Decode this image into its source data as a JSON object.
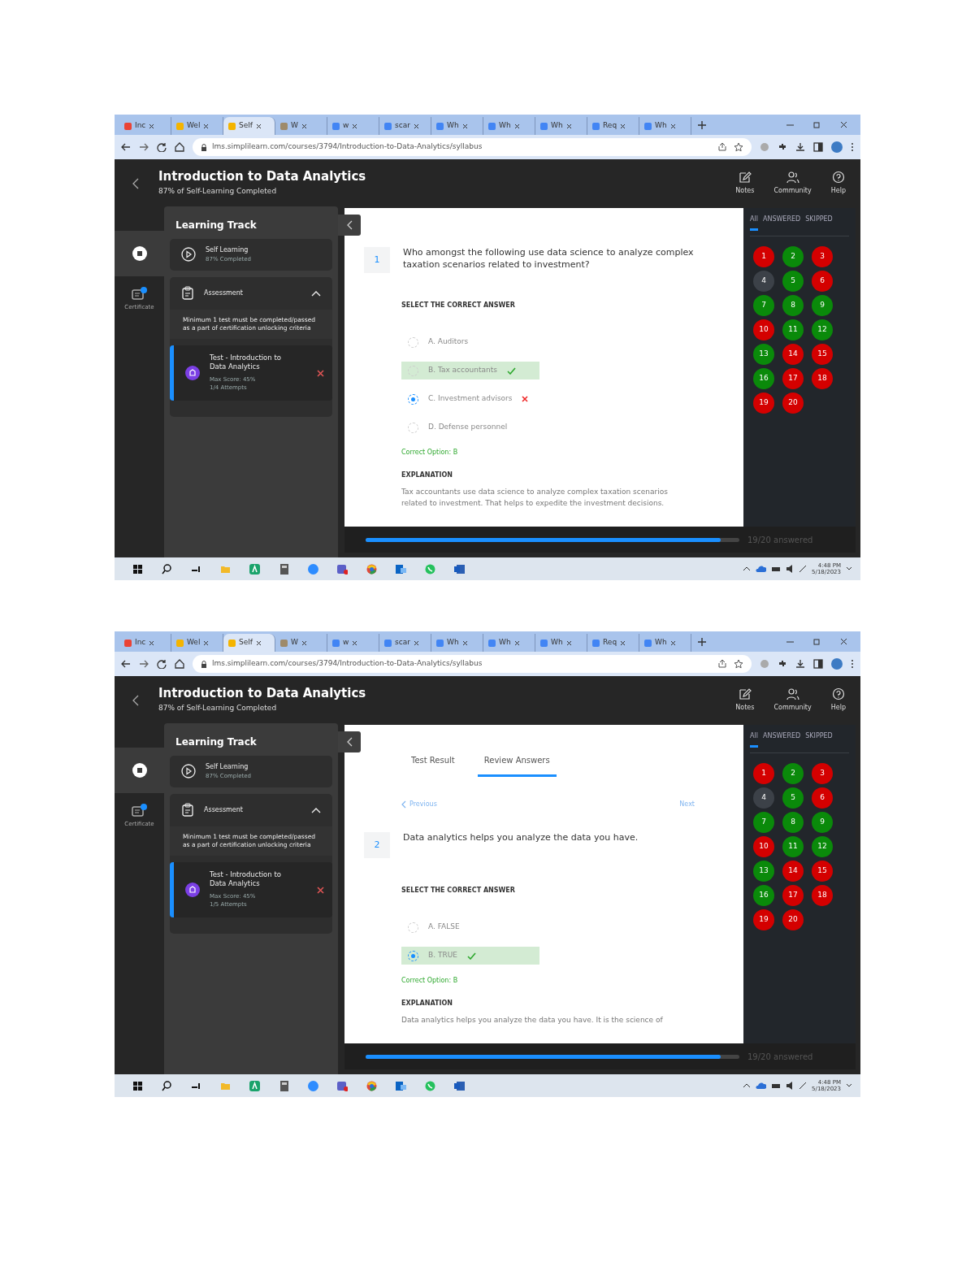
{
  "screens": [
    {
      "browser": {
        "tabs": [
          {
            "title": "Inc",
            "selected": false,
            "color": "#ea4335"
          },
          {
            "title": "Wel",
            "selected": false,
            "color": "#f4b400"
          },
          {
            "title": "Self",
            "selected": true,
            "color": "#f4b400"
          },
          {
            "title": "W",
            "selected": false,
            "color": "#9e8a6a"
          },
          {
            "title": "w",
            "selected": false,
            "color": "#4285f4"
          },
          {
            "title": "scar",
            "selected": false,
            "color": "#4285f4"
          },
          {
            "title": "Wh",
            "selected": false,
            "color": "#4285f4"
          },
          {
            "title": "Wh",
            "selected": false,
            "color": "#4285f4"
          },
          {
            "title": "Wh",
            "selected": false,
            "color": "#4285f4"
          },
          {
            "title": "Req",
            "selected": false,
            "color": "#4285f4"
          },
          {
            "title": "Wh",
            "selected": false,
            "color": "#4285f4"
          }
        ],
        "url": "lms.simplilearn.com/courses/3794/Introduction-to-Data-Analytics/syllabus"
      },
      "header": {
        "title": "Introduction to Data Analytics",
        "subtitle": "87% of Self-Learning Completed",
        "actions": [
          {
            "kind": "notes",
            "label": "Notes"
          },
          {
            "kind": "community",
            "label": "Community"
          },
          {
            "kind": "help",
            "label": "Help"
          }
        ]
      },
      "rail": [
        {
          "kind": "home",
          "selected": true
        },
        {
          "kind": "certificate",
          "label": "Certificate",
          "selected": false
        }
      ],
      "learning_track": {
        "title": "Learning Track",
        "self_learning": {
          "title": "Self Learning",
          "progress": "87% Completed"
        },
        "assessment": {
          "title": "Assessment",
          "expanded": true,
          "note": "Minimum 1 test must be completed/passed as a part of certification unlocking criteria",
          "test": {
            "title": "Test - Introduction to Data Analytics",
            "score": "Max Score: 45%",
            "attempts": "1/4 Attempts"
          }
        }
      },
      "review": {
        "number": "1",
        "question": "Who amongst the following use data science to analyze complex taxation scenarios related to investment?",
        "instruction": "SELECT THE CORRECT ANSWER",
        "options": [
          {
            "label": "A. Auditors",
            "selected": false,
            "correct": false
          },
          {
            "label": "B. Tax accountants",
            "selected": false,
            "correct": true
          },
          {
            "label": "C. Investment advisors",
            "selected": true,
            "correct": false
          },
          {
            "label": "D. Defense personnel",
            "selected": false,
            "correct": false
          }
        ],
        "correct_option": "Correct Option: B",
        "explanation_heading": "EXPLANATION",
        "explanation": "Tax accountants use data science to analyze complex taxation scenarios related to investment. That helps to expedite the investment decisions."
      },
      "palette": {
        "filters": [
          {
            "label": "All",
            "selected": true
          },
          {
            "label": "ANSWERED",
            "selected": false
          },
          {
            "label": "SKIPPED",
            "selected": false
          }
        ],
        "questions": [
          {
            "number": "1",
            "color": "#d40000"
          },
          {
            "number": "2",
            "color": "#0a8a0a"
          },
          {
            "number": "3",
            "color": "#d40000"
          },
          {
            "number": "4",
            "color": "#3c4148"
          },
          {
            "number": "5",
            "color": "#0a8a0a"
          },
          {
            "number": "6",
            "color": "#d40000"
          },
          {
            "number": "7",
            "color": "#0a8a0a"
          },
          {
            "number": "8",
            "color": "#0a8a0a"
          },
          {
            "number": "9",
            "color": "#0a8a0a"
          },
          {
            "number": "10",
            "color": "#d40000"
          },
          {
            "number": "11",
            "color": "#0a8a0a"
          },
          {
            "number": "12",
            "color": "#0a8a0a"
          },
          {
            "number": "13",
            "color": "#0a8a0a"
          },
          {
            "number": "14",
            "color": "#d40000"
          },
          {
            "number": "15",
            "color": "#d40000"
          },
          {
            "number": "16",
            "color": "#0a8a0a"
          },
          {
            "number": "17",
            "color": "#d40000"
          },
          {
            "number": "18",
            "color": "#d40000"
          },
          {
            "number": "19",
            "color": "#d40000"
          },
          {
            "number": "20",
            "color": "#d40000"
          }
        ]
      },
      "progress": {
        "level": 0.95,
        "label": "19/20 answered"
      },
      "taskbar": {
        "time": "4:48 PM",
        "date": "5/18/2023"
      }
    },
    {
      "browser": {
        "tabs": [
          {
            "title": "Inc",
            "selected": false,
            "color": "#ea4335"
          },
          {
            "title": "Wel",
            "selected": false,
            "color": "#f4b400"
          },
          {
            "title": "Self",
            "selected": true,
            "color": "#f4b400"
          },
          {
            "title": "W",
            "selected": false,
            "color": "#9e8a6a"
          },
          {
            "title": "w",
            "selected": false,
            "color": "#4285f4"
          },
          {
            "title": "scar",
            "selected": false,
            "color": "#4285f4"
          },
          {
            "title": "Wh",
            "selected": false,
            "color": "#4285f4"
          },
          {
            "title": "Wh",
            "selected": false,
            "color": "#4285f4"
          },
          {
            "title": "Wh",
            "selected": false,
            "color": "#4285f4"
          },
          {
            "title": "Req",
            "selected": false,
            "color": "#4285f4"
          },
          {
            "title": "Wh",
            "selected": false,
            "color": "#4285f4"
          }
        ],
        "url": "lms.simplilearn.com/courses/3794/Introduction-to-Data-Analytics/syllabus"
      },
      "header": {
        "title": "Introduction to Data Analytics",
        "subtitle": "87% of Self-Learning Completed",
        "actions": [
          {
            "kind": "notes",
            "label": "Notes"
          },
          {
            "kind": "community",
            "label": "Community"
          },
          {
            "kind": "help",
            "label": "Help"
          }
        ]
      },
      "rail": [
        {
          "kind": "home",
          "selected": true
        },
        {
          "kind": "certificate",
          "label": "Certificate",
          "selected": false
        }
      ],
      "learning_track": {
        "title": "Learning Track",
        "self_learning": {
          "title": "Self Learning",
          "progress": "87% Completed"
        },
        "assessment": {
          "title": "Assessment",
          "expanded": true,
          "note": "Minimum 1 test must be completed/passed as a part of certification unlocking criteria",
          "test": {
            "title": "Test - Introduction to Data Analytics",
            "score": "Max Score: 45%",
            "attempts": "1/5 Attempts"
          }
        }
      },
      "review": {
        "result_tabs": [
          {
            "label": "Test Result",
            "selected": false
          },
          {
            "label": "Review Answers",
            "selected": true
          }
        ],
        "previous": "Previous",
        "next": "Next",
        "number": "2",
        "question": "Data analytics helps you analyze the data you have.",
        "instruction": "SELECT THE CORRECT ANSWER",
        "options": [
          {
            "label": "A. FALSE",
            "selected": false,
            "correct": false
          },
          {
            "label": "B. TRUE",
            "selected": true,
            "correct": true
          }
        ],
        "correct_option": "Correct Option: B",
        "explanation_heading": "EXPLANATION",
        "explanation": "Data analytics helps you analyze the data you have. It is the science of"
      },
      "palette": {
        "filters": [
          {
            "label": "All",
            "selected": true
          },
          {
            "label": "ANSWERED",
            "selected": false
          },
          {
            "label": "SKIPPED",
            "selected": false
          }
        ],
        "questions": [
          {
            "number": "1",
            "color": "#d40000"
          },
          {
            "number": "2",
            "color": "#0a8a0a"
          },
          {
            "number": "3",
            "color": "#d40000"
          },
          {
            "number": "4",
            "color": "#3c4148"
          },
          {
            "number": "5",
            "color": "#0a8a0a"
          },
          {
            "number": "6",
            "color": "#d40000"
          },
          {
            "number": "7",
            "color": "#0a8a0a"
          },
          {
            "number": "8",
            "color": "#0a8a0a"
          },
          {
            "number": "9",
            "color": "#0a8a0a"
          },
          {
            "number": "10",
            "color": "#d40000"
          },
          {
            "number": "11",
            "color": "#0a8a0a"
          },
          {
            "number": "12",
            "color": "#0a8a0a"
          },
          {
            "number": "13",
            "color": "#0a8a0a"
          },
          {
            "number": "14",
            "color": "#d40000"
          },
          {
            "number": "15",
            "color": "#d40000"
          },
          {
            "number": "16",
            "color": "#0a8a0a"
          },
          {
            "number": "17",
            "color": "#d40000"
          },
          {
            "number": "18",
            "color": "#d40000"
          },
          {
            "number": "19",
            "color": "#d40000"
          },
          {
            "number": "20",
            "color": "#d40000"
          }
        ]
      },
      "progress": {
        "level": 0.95,
        "label": "19/20 answered"
      },
      "taskbar": {
        "time": "4:48 PM",
        "date": "5/18/2023"
      }
    }
  ]
}
